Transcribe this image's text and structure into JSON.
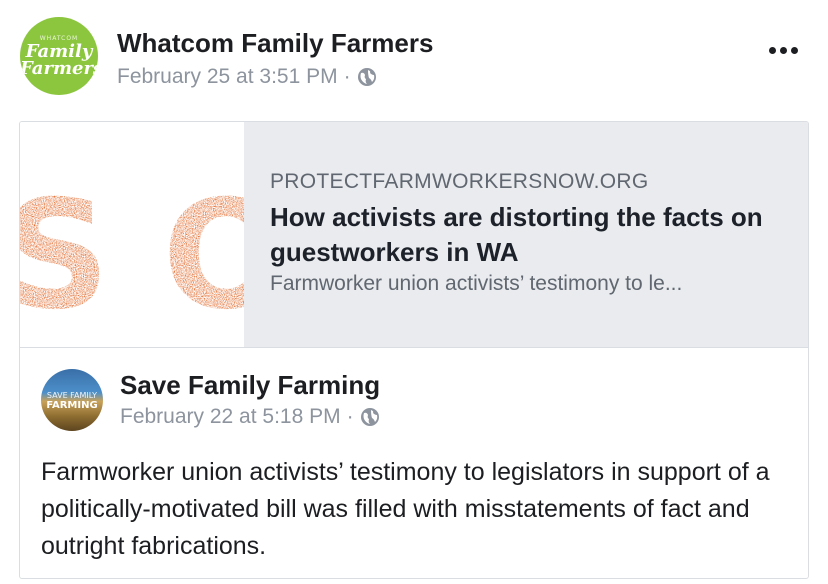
{
  "post": {
    "page_name": "Whatcom Family Farmers",
    "timestamp": "February 25 at 3:51 PM",
    "separator": "·",
    "privacy_icon": "globe-icon",
    "more_icon": "more-options-icon",
    "avatar": {
      "small_text": "WHATCOM",
      "line1": "Family",
      "line2": "Farmers",
      "color": "#8cc63f"
    }
  },
  "link_preview": {
    "image_text": "S ON",
    "image_color": "#e0601f",
    "domain": "PROTECTFARMWORKERSNOW.ORG",
    "title": "How activists are distorting the facts on guestworkers in WA",
    "description": "Farmworker union activists’ testimony to le..."
  },
  "shared_post": {
    "page_name": "Save Family Farming",
    "timestamp": "February 22 at 5:18 PM",
    "separator": "·",
    "privacy_icon": "globe-icon",
    "avatar": {
      "line1": "SAVE FAMILY",
      "line2": "FARMING"
    },
    "text": "Farmworker union activists’ testimony to legislators in support of a politically-motivated bill was filled with misstatements of fact and outright fabrications."
  }
}
